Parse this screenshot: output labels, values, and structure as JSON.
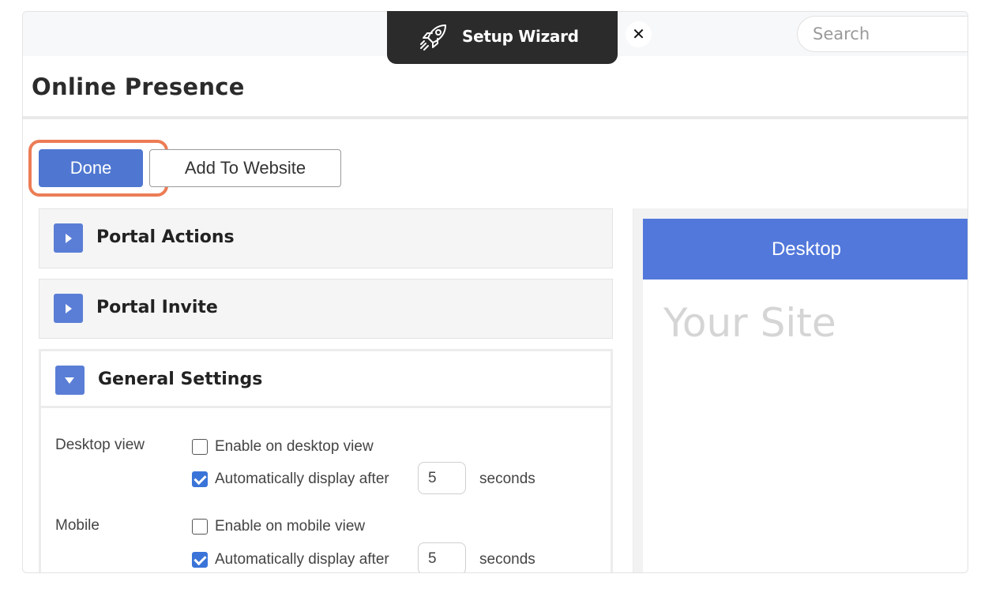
{
  "header": {
    "search_placeholder": "Search"
  },
  "page": {
    "title": "Online Presence"
  },
  "toolbar": {
    "done_label": "Done",
    "add_label": "Add To Website"
  },
  "sections": {
    "portal_actions": "Portal Actions",
    "portal_invite": "Portal Invite",
    "general_settings": "General Settings"
  },
  "settings": {
    "desktop": {
      "label": "Desktop view",
      "enable_label": "Enable on desktop view",
      "enable_checked": false,
      "auto_label": "Automatically display after",
      "auto_checked": true,
      "seconds": "5",
      "unit": "seconds"
    },
    "mobile": {
      "label": "Mobile",
      "enable_label": "Enable on mobile view",
      "enable_checked": false,
      "auto_label": "Automatically display after",
      "auto_checked": true,
      "seconds": "5",
      "unit": "seconds"
    }
  },
  "preview": {
    "tab_label": "Desktop",
    "site_text": "Your Site"
  },
  "wizard": {
    "label": "Setup Wizard",
    "close_symbol": "✕"
  },
  "colors": {
    "primary": "#4f77d1",
    "highlight": "#ec7c55",
    "wizard_bg": "#2b2b2b"
  }
}
